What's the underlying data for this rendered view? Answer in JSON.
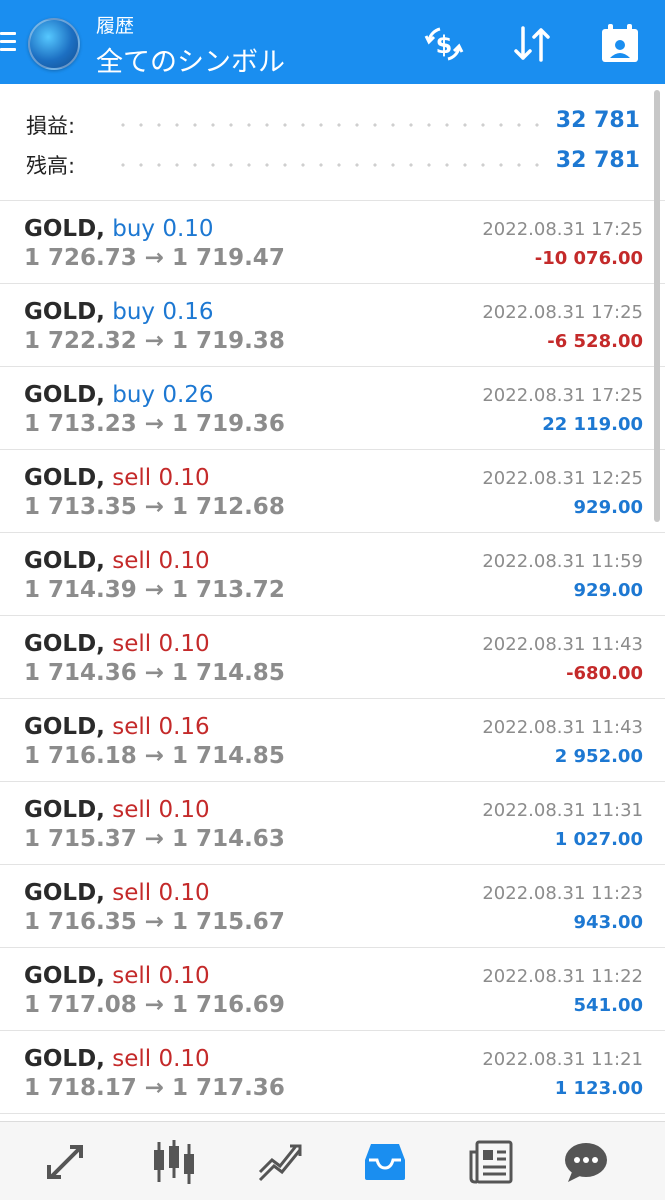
{
  "header": {
    "subtitle": "履歴",
    "title": "全てのシンボル",
    "menu_icon": "hamburger-menu-icon",
    "logo_icon": "metatrader-logo-icon",
    "actions": [
      "currency-exchange-icon",
      "sort-arrows-icon",
      "calendar-icon"
    ]
  },
  "summary": {
    "profit_label": "損益:",
    "profit_value": "32 781",
    "balance_label": "残高:",
    "balance_value": "32 781"
  },
  "deals": [
    {
      "symbol": "GOLD,",
      "side": "buy 0.10",
      "prices": "1 726.73 → 1 719.47",
      "time": "2022.08.31 17:25",
      "profit": "-10 076.00",
      "kind": "buy",
      "sign": "neg"
    },
    {
      "symbol": "GOLD,",
      "side": "buy 0.16",
      "prices": "1 722.32 → 1 719.38",
      "time": "2022.08.31 17:25",
      "profit": "-6 528.00",
      "kind": "buy",
      "sign": "neg"
    },
    {
      "symbol": "GOLD,",
      "side": "buy 0.26",
      "prices": "1 713.23 → 1 719.36",
      "time": "2022.08.31 17:25",
      "profit": "22 119.00",
      "kind": "buy",
      "sign": "pos"
    },
    {
      "symbol": "GOLD,",
      "side": "sell 0.10",
      "prices": "1 713.35 → 1 712.68",
      "time": "2022.08.31 12:25",
      "profit": "929.00",
      "kind": "sell",
      "sign": "pos"
    },
    {
      "symbol": "GOLD,",
      "side": "sell 0.10",
      "prices": "1 714.39 → 1 713.72",
      "time": "2022.08.31 11:59",
      "profit": "929.00",
      "kind": "sell",
      "sign": "pos"
    },
    {
      "symbol": "GOLD,",
      "side": "sell 0.10",
      "prices": "1 714.36 → 1 714.85",
      "time": "2022.08.31 11:43",
      "profit": "-680.00",
      "kind": "sell",
      "sign": "neg"
    },
    {
      "symbol": "GOLD,",
      "side": "sell 0.16",
      "prices": "1 716.18 → 1 714.85",
      "time": "2022.08.31 11:43",
      "profit": "2 952.00",
      "kind": "sell",
      "sign": "pos"
    },
    {
      "symbol": "GOLD,",
      "side": "sell 0.10",
      "prices": "1 715.37 → 1 714.63",
      "time": "2022.08.31 11:31",
      "profit": "1 027.00",
      "kind": "sell",
      "sign": "pos"
    },
    {
      "symbol": "GOLD,",
      "side": "sell 0.10",
      "prices": "1 716.35 → 1 715.67",
      "time": "2022.08.31 11:23",
      "profit": "943.00",
      "kind": "sell",
      "sign": "pos"
    },
    {
      "symbol": "GOLD,",
      "side": "sell 0.10",
      "prices": "1 717.08 → 1 716.69",
      "time": "2022.08.31 11:22",
      "profit": "541.00",
      "kind": "sell",
      "sign": "pos"
    },
    {
      "symbol": "GOLD,",
      "side": "sell 0.10",
      "prices": "1 718.17 → 1 717.36",
      "time": "2022.08.31 11:21",
      "profit": "1 123.00",
      "kind": "sell",
      "sign": "pos"
    }
  ],
  "bottom_nav": [
    {
      "icon": "quotes-arrows-icon",
      "active": false
    },
    {
      "icon": "candlestick-chart-icon",
      "active": false
    },
    {
      "icon": "trade-chart-icon",
      "active": false
    },
    {
      "icon": "history-inbox-icon",
      "active": true
    },
    {
      "icon": "news-icon",
      "active": false
    },
    {
      "icon": "chat-bubble-icon",
      "active": false
    }
  ],
  "colors": {
    "header": "#1a8ef0",
    "positive": "#1d78d2",
    "negative": "#c42a2a",
    "muted": "#8c8c8c",
    "nav_active": "#1a8ef0",
    "nav_inactive": "#555555"
  }
}
